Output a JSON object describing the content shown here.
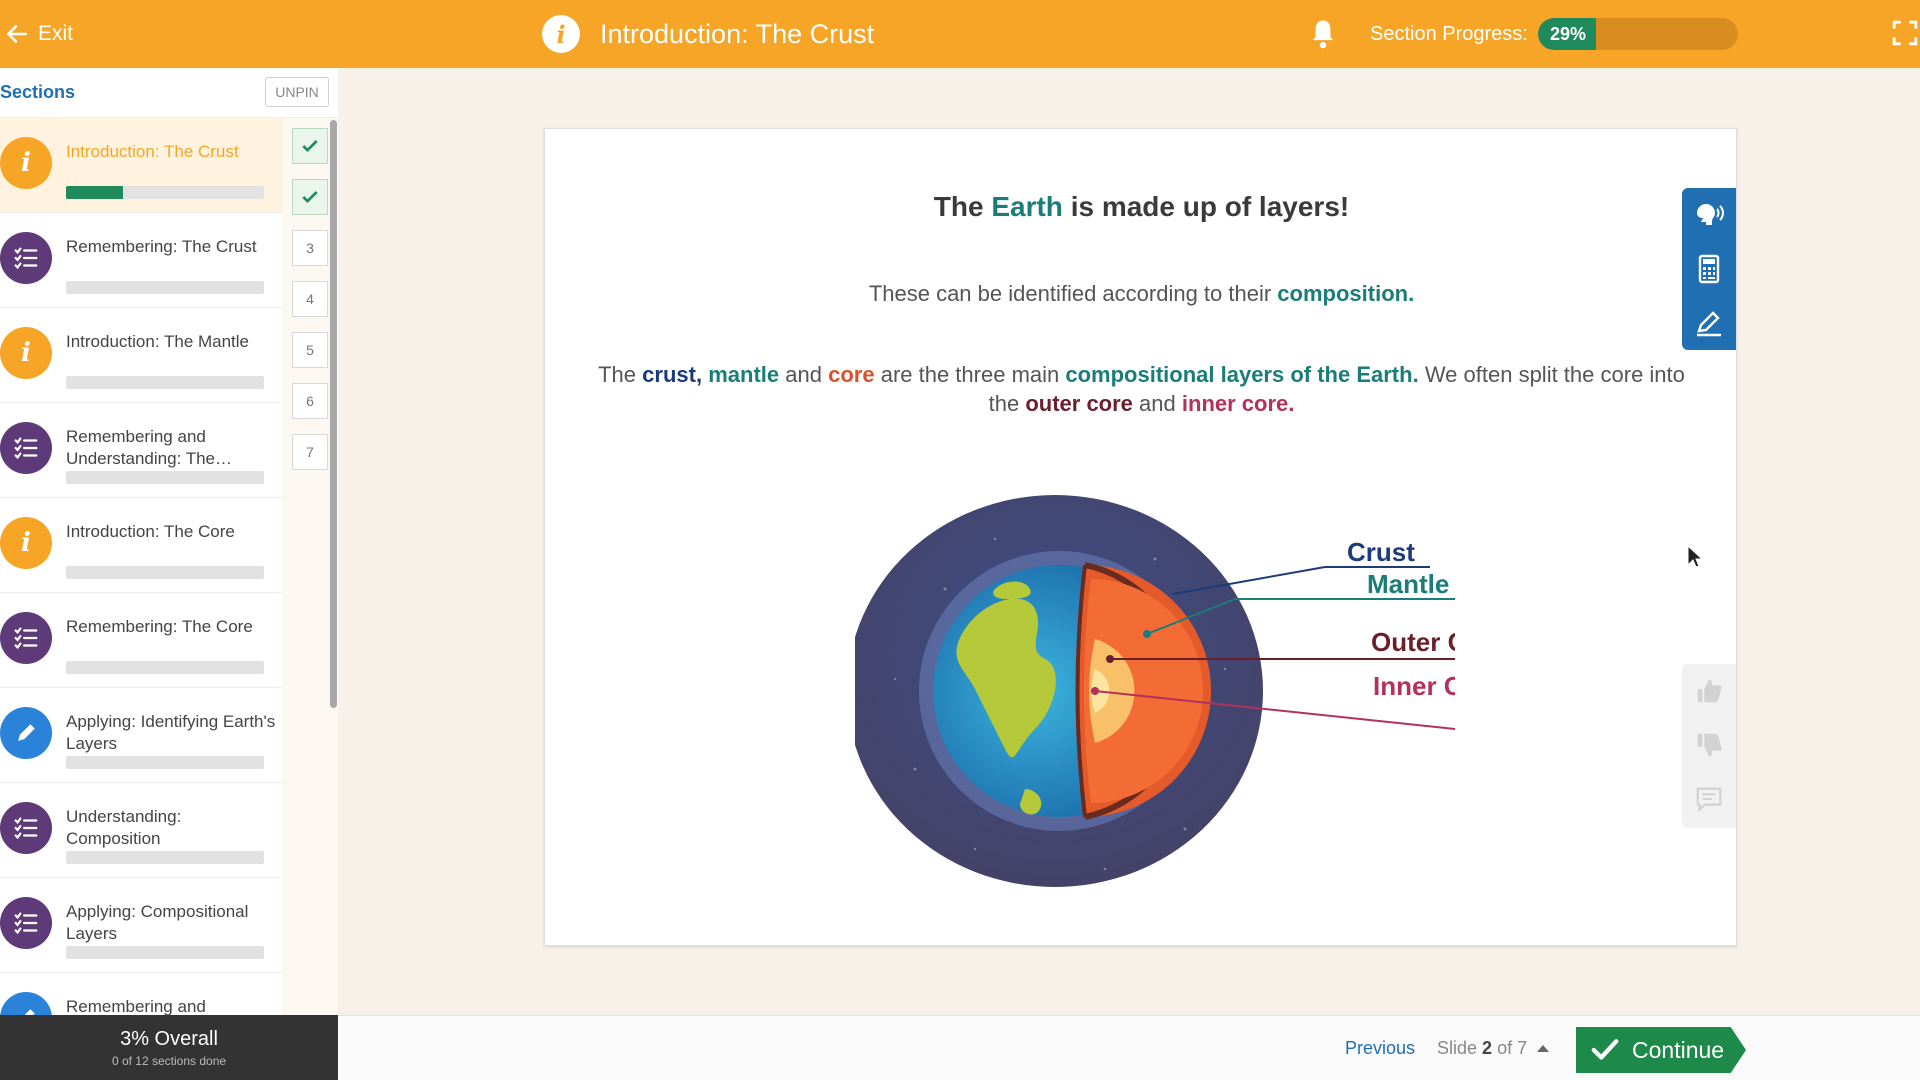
{
  "topbar": {
    "exit_label": "Exit",
    "title": "Introduction: The Crust",
    "info_glyph": "i",
    "progress_label": "Section Progress:",
    "progress_value": "29%",
    "progress_fraction": 0.29,
    "icons": [
      "back-arrow-icon",
      "info-icon",
      "bell-icon",
      "fullscreen-icon"
    ],
    "bg_color": "#f7a526"
  },
  "sidebar": {
    "title": "Sections",
    "unpin_label": "UNPIN",
    "items": [
      {
        "label": "Introduction: The Crust",
        "type": "info",
        "progress": 0.29,
        "active": true
      },
      {
        "label": "Remembering: The Crust",
        "type": "list",
        "progress": 0
      },
      {
        "label": "Introduction: The Mantle",
        "type": "info",
        "progress": 0
      },
      {
        "label": "Remembering and Understanding: The…",
        "type": "list",
        "progress": 0
      },
      {
        "label": "Introduction: The Core",
        "type": "info",
        "progress": 0
      },
      {
        "label": "Remembering: The Core",
        "type": "list",
        "progress": 0
      },
      {
        "label": "Applying: Identifying Earth's Layers",
        "type": "pencil",
        "progress": 0
      },
      {
        "label": "Understanding: Composition",
        "type": "list",
        "progress": 0
      },
      {
        "label": "Applying: Compositional Layers",
        "type": "list",
        "progress": 0
      },
      {
        "label": "Remembering and",
        "type": "pencil",
        "progress": 0
      }
    ],
    "slide_numbers": [
      "✓",
      "✓",
      "3",
      "4",
      "5",
      "6",
      "7"
    ],
    "overall": "3% Overall",
    "overall_sub": "0 of 12 sections done"
  },
  "slide": {
    "heading_pre": "The",
    "heading_earth": "Earth",
    "heading_post": "is made up of layers!",
    "sub_pre": "These can be identified according to their",
    "sub_word": "composition.",
    "para": {
      "t1": "The",
      "crust": "crust,",
      "mantle": "mantle",
      "t2": "and",
      "core": "core",
      "t3": "are the three main",
      "comp": "compositional layers of the Earth.",
      "t4": "We often split the core into the",
      "outer": "outer core",
      "t5": "and",
      "inner": "inner core."
    },
    "labels": {
      "crust": "Crust",
      "mantle": "Mantle",
      "outer": "Outer Core",
      "inner": "Inner Core"
    }
  },
  "tools": [
    "text-to-speech-icon",
    "calculator-icon",
    "pencil-icon"
  ],
  "feedback": [
    "thumbs-up-icon",
    "thumbs-down-icon",
    "comment-icon"
  ],
  "bottombar": {
    "previous_label": "Previous",
    "slide_prefix": "Slide",
    "slide_current": "2",
    "slide_suffix": "of 7",
    "continue_label": "Continue"
  }
}
